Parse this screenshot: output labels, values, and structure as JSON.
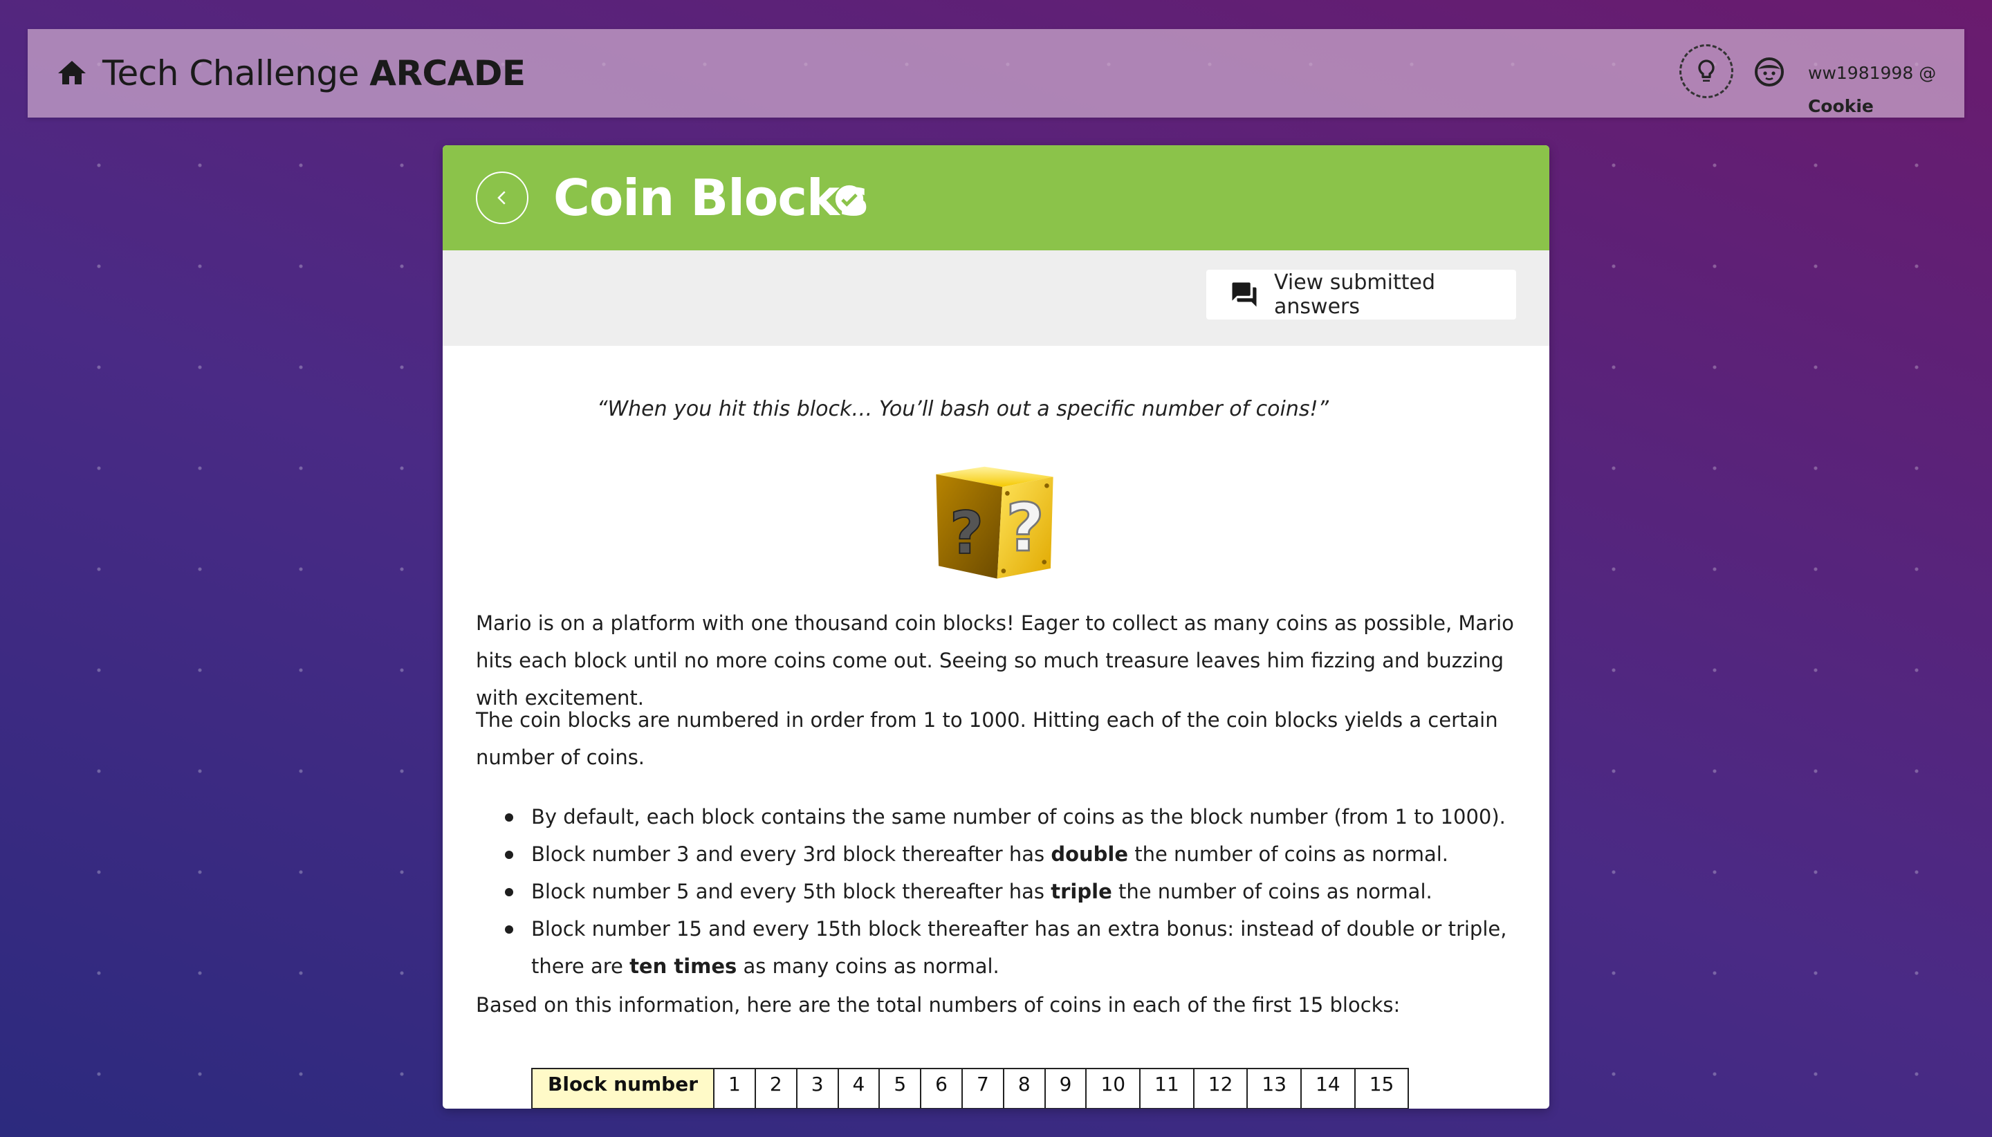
{
  "header": {
    "brand_light": "Tech Challenge",
    "brand_heavy": "ARCADE",
    "username": "ww1981998",
    "at": "@",
    "nickname": "Cookie"
  },
  "challenge": {
    "title": "Coin Blocks",
    "completed": true,
    "view_answers_label": "View submitted answers",
    "quote": "“When you hit this block… You’ll bash out a specific number of coins!”",
    "paragraph1": "Mario is on a platform with one thousand coin blocks! Eager to collect as many coins as possible, Mario hits each block until no more coins come out. Seeing so much treasure leaves him fizzing and buzzing with excitement.",
    "paragraph2": "The coin blocks are numbered in order from 1 to 1000. Hitting each of the coin blocks yields a certain number of coins.",
    "bullets": [
      {
        "before": "By default, each block contains the same number of coins as the block number (from 1 to 1000).",
        "bold": "",
        "after": ""
      },
      {
        "before": "Block number 3 and every 3rd block thereafter has ",
        "bold": "double",
        "after": " the number of coins as normal."
      },
      {
        "before": "Block number 5 and every 5th block thereafter has ",
        "bold": "triple",
        "after": " the number of coins as normal."
      },
      {
        "before": "Block number 15 and every 15th block thereafter has an extra bonus: instead of double or triple, there are ",
        "bold": "ten times",
        "after": " as many coins as normal."
      }
    ],
    "paragraph3": "Based on this information, here are the total numbers of coins in each of the first 15 blocks:",
    "table_header": "Block number",
    "table_numbers": [
      "1",
      "2",
      "3",
      "4",
      "5",
      "6",
      "7",
      "8",
      "9",
      "10",
      "11",
      "12",
      "13",
      "14",
      "15"
    ]
  },
  "colors": {
    "title_bar": "#8bc34a",
    "toolbar": "#eeeeee",
    "table_header_bg": "#fffac8"
  },
  "icons": {
    "home": "home-icon",
    "hint": "lightbulb-icon",
    "avatar": "face-icon",
    "back": "chevron-left-icon",
    "completed": "check-circle-icon",
    "answers": "forum-icon"
  }
}
